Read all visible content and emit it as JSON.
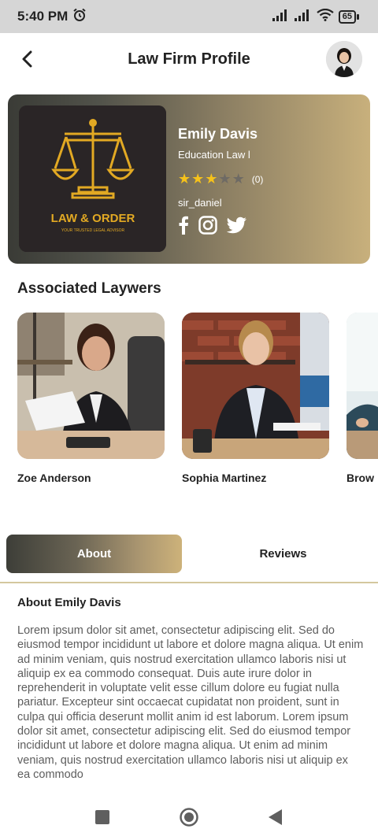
{
  "status_bar": {
    "time": "5:40 PM",
    "battery": "65"
  },
  "header": {
    "title": "Law Firm Profile"
  },
  "profile": {
    "name": "Emily Davis",
    "specialty": "Education Law l",
    "rating": 3,
    "rating_max": 5,
    "rating_count": "(0)",
    "username": "sir_daniel",
    "logo_text": "LAW & ORDER",
    "logo_tagline": "YOUR TRUSTED LEGAL ADVISOR",
    "socials": [
      "facebook-icon",
      "instagram-icon",
      "twitter-icon"
    ]
  },
  "lawyers_section": {
    "title": "Associated Laywers",
    "items": [
      {
        "name": "Zoe Anderson"
      },
      {
        "name": "Sophia Martinez"
      },
      {
        "name": "Brow"
      }
    ]
  },
  "tabs": {
    "about": "About",
    "reviews": "Reviews",
    "active": "about"
  },
  "about": {
    "title": "About Emily Davis",
    "body": "Lorem ipsum dolor sit amet, consectetur adipiscing elit. Sed do eiusmod tempor incididunt ut labore et dolore magna aliqua. Ut enim ad minim veniam, quis nostrud exercitation ullamco laboris nisi ut aliquip ex ea commodo consequat. Duis aute irure dolor in reprehenderit in voluptate velit esse cillum dolore eu fugiat nulla pariatur. Excepteur sint occaecat cupidatat non proident, sunt in culpa qui officia deserunt mollit anim id est laborum. Lorem ipsum dolor sit amet, consectetur adipiscing elit. Sed do eiusmod tempor incididunt ut labore et dolore magna aliqua. Ut enim ad minim veniam, quis nostrud exercitation ullamco laboris nisi ut aliquip ex ea commodo"
  },
  "colors": {
    "accent_gold": "#c8b07c",
    "dark": "#3a3b36",
    "star": "#f6c21a"
  },
  "nav": {
    "icons": [
      "square-icon",
      "home-circle-icon",
      "back-triangle-icon"
    ]
  }
}
